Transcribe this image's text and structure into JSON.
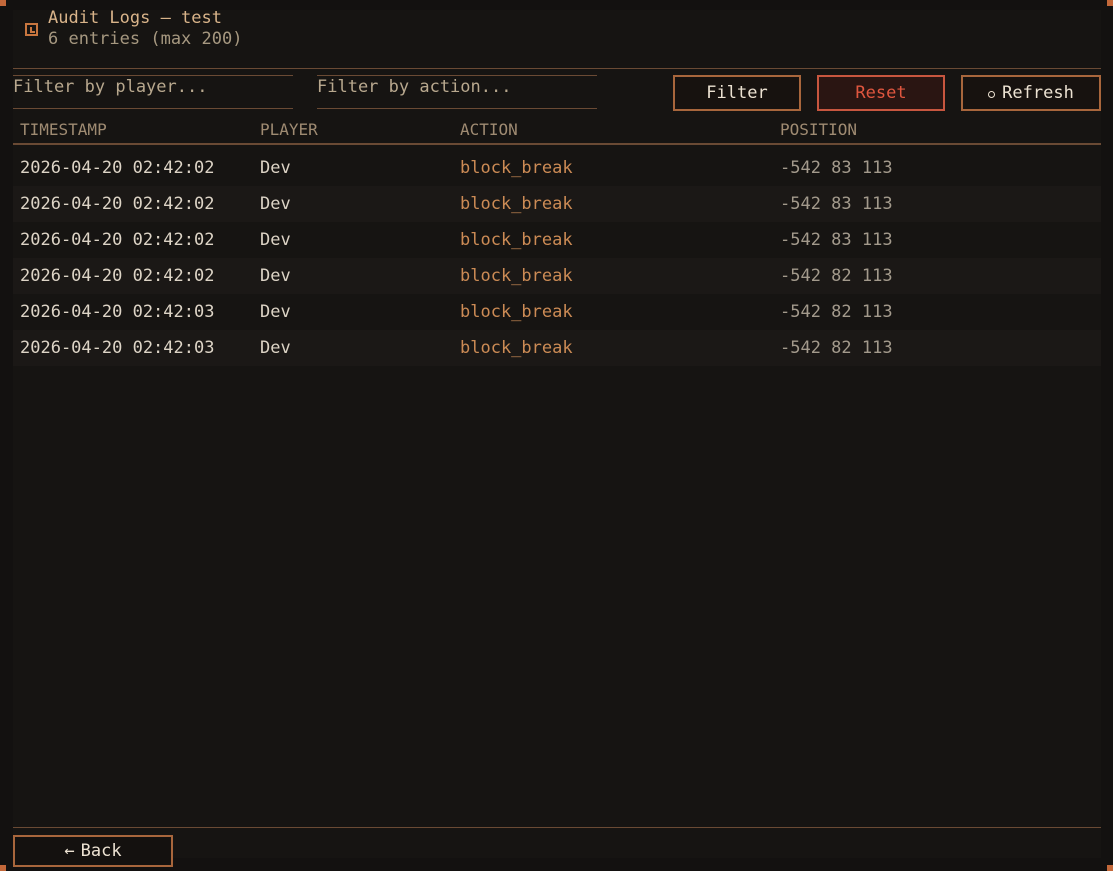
{
  "header": {
    "title": "Audit Logs — test",
    "subtitle": "6 entries (max 200)",
    "icon": "clock-icon"
  },
  "filters": {
    "player_placeholder": "Filter by player...",
    "action_placeholder": "Filter by action..."
  },
  "toolbar": {
    "filter_label": "Filter",
    "reset_label": "Reset",
    "refresh_label": "Refresh"
  },
  "table": {
    "columns": [
      "TIMESTAMP",
      "PLAYER",
      "ACTION",
      "POSITION"
    ],
    "rows": [
      {
        "timestamp": "2026-04-20 02:42:02",
        "player": "Dev",
        "action": "block_break",
        "position": "-542 83 113"
      },
      {
        "timestamp": "2026-04-20 02:42:02",
        "player": "Dev",
        "action": "block_break",
        "position": "-542 83 113"
      },
      {
        "timestamp": "2026-04-20 02:42:02",
        "player": "Dev",
        "action": "block_break",
        "position": "-542 83 113"
      },
      {
        "timestamp": "2026-04-20 02:42:02",
        "player": "Dev",
        "action": "block_break",
        "position": "-542 82 113"
      },
      {
        "timestamp": "2026-04-20 02:42:03",
        "player": "Dev",
        "action": "block_break",
        "position": "-542 82 113"
      },
      {
        "timestamp": "2026-04-20 02:42:03",
        "player": "Dev",
        "action": "block_break",
        "position": "-542 82 113"
      }
    ]
  },
  "footer": {
    "back_label": "Back"
  },
  "colors": {
    "accent": "#c8763f",
    "action_text": "#cc8b55",
    "reset": "#e0563f",
    "background": "#161412"
  }
}
